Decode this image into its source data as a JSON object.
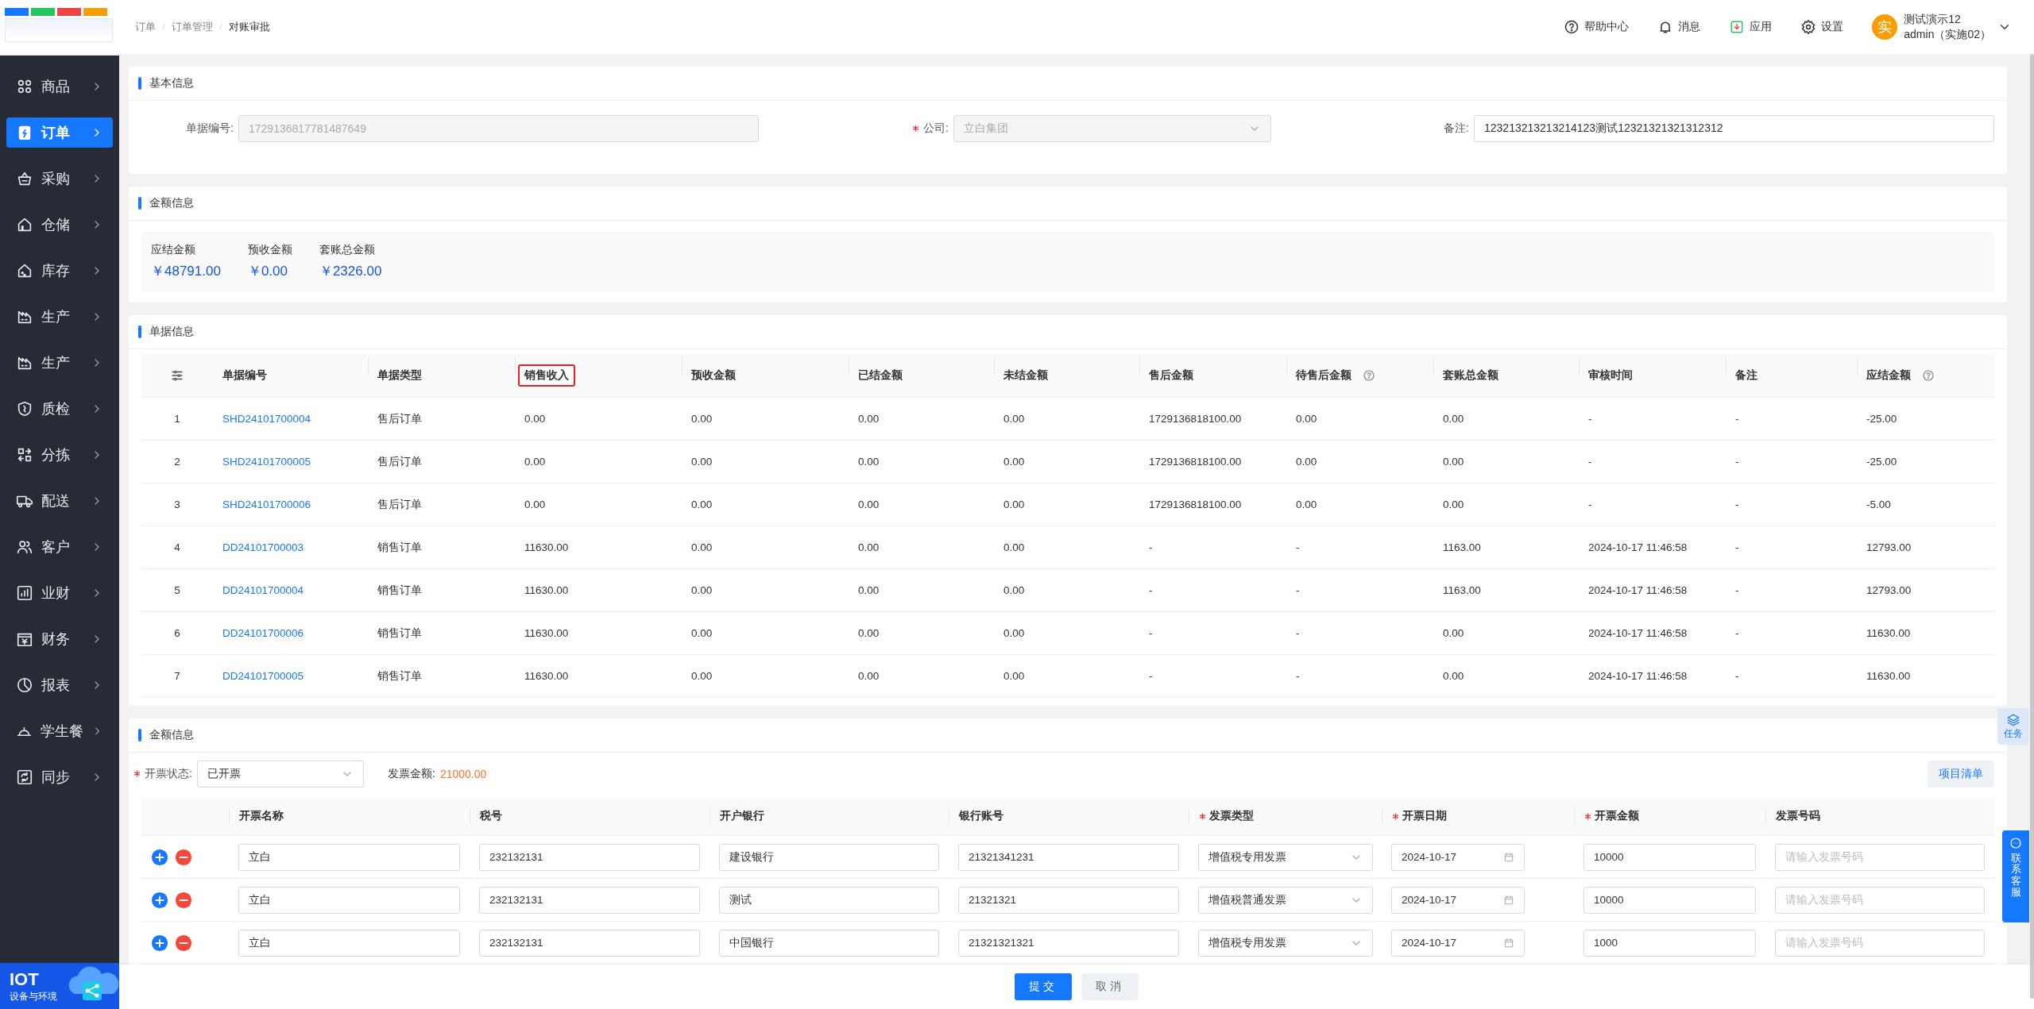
{
  "sidebar": {
    "items": [
      {
        "label": "商品",
        "selected": false
      },
      {
        "label": "订单",
        "selected": true
      },
      {
        "label": "采购",
        "selected": false
      },
      {
        "label": "仓储",
        "selected": false
      },
      {
        "label": "库存",
        "selected": false
      },
      {
        "label": "生产",
        "selected": false
      },
      {
        "label": "生产",
        "selected": false
      },
      {
        "label": "质检",
        "selected": false
      },
      {
        "label": "分拣",
        "selected": false
      },
      {
        "label": "配送",
        "selected": false
      },
      {
        "label": "客户",
        "selected": false
      },
      {
        "label": "业财",
        "selected": false
      },
      {
        "label": "财务",
        "selected": false
      },
      {
        "label": "报表",
        "selected": false
      },
      {
        "label": "学生餐",
        "selected": false
      },
      {
        "label": "同步",
        "selected": false
      }
    ],
    "banner": {
      "title": "IOT",
      "subtitle": "设备与环境"
    }
  },
  "breadcrumb": [
    "订单",
    "订单管理",
    "对账审批"
  ],
  "header_actions": [
    {
      "label": "帮助中心"
    },
    {
      "label": "消息"
    },
    {
      "label": "应用"
    },
    {
      "label": "设置"
    }
  ],
  "user": {
    "avatar_text": "实",
    "name": "测试演示12",
    "role": "admin（实施02）"
  },
  "basic_info": {
    "title": "基本信息",
    "fields": [
      {
        "label": "单据编号:",
        "value": "1729136817781487649",
        "kind": "input",
        "required": false,
        "disabled": true
      },
      {
        "label": "公司:",
        "value": "立白集团",
        "kind": "select",
        "required": true,
        "disabled": true
      },
      {
        "label": "备注:",
        "value": "123213213213214123测试12321321321312312",
        "kind": "input",
        "required": false,
        "disabled": false
      }
    ]
  },
  "amount_info": {
    "title": "金额信息",
    "stats": [
      {
        "label": "应结金额",
        "value": "￥48791.00"
      },
      {
        "label": "预收金额",
        "value": "￥0.00"
      },
      {
        "label": "套账总金额",
        "value": "￥2326.00"
      }
    ]
  },
  "documents": {
    "title": "单据信息",
    "columns": [
      {
        "label": "单据编号",
        "kind": "link",
        "highlighted": false,
        "help": false
      },
      {
        "label": "单据类型",
        "kind": "text",
        "highlighted": false,
        "help": false
      },
      {
        "label": "销售收入",
        "kind": "text",
        "highlighted": true,
        "help": false
      },
      {
        "label": "预收金额",
        "kind": "text",
        "highlighted": false,
        "help": false
      },
      {
        "label": "已结金额",
        "kind": "text",
        "highlighted": false,
        "help": false
      },
      {
        "label": "未结金额",
        "kind": "text",
        "highlighted": false,
        "help": false
      },
      {
        "label": "售后金额",
        "kind": "text",
        "highlighted": false,
        "help": false
      },
      {
        "label": "待售后金额",
        "kind": "text",
        "highlighted": false,
        "help": true
      },
      {
        "label": "套账总金额",
        "kind": "text",
        "highlighted": false,
        "help": false
      },
      {
        "label": "审核时间",
        "kind": "text",
        "highlighted": false,
        "help": false
      },
      {
        "label": "备注",
        "kind": "text",
        "highlighted": false,
        "help": false
      },
      {
        "label": "应结金额",
        "kind": "text",
        "highlighted": false,
        "help": true
      }
    ],
    "rows": [
      {
        "index": "1",
        "cells": [
          "SHD24101700004",
          "售后订单",
          "0.00",
          "0.00",
          "0.00",
          "0.00",
          "1729136818100.00",
          "0.00",
          "0.00",
          "-",
          "-",
          "-25.00"
        ]
      },
      {
        "index": "2",
        "cells": [
          "SHD24101700005",
          "售后订单",
          "0.00",
          "0.00",
          "0.00",
          "0.00",
          "1729136818100.00",
          "0.00",
          "0.00",
          "-",
          "-",
          "-25.00"
        ]
      },
      {
        "index": "3",
        "cells": [
          "SHD24101700006",
          "售后订单",
          "0.00",
          "0.00",
          "0.00",
          "0.00",
          "1729136818100.00",
          "0.00",
          "0.00",
          "-",
          "-",
          "-5.00"
        ]
      },
      {
        "index": "4",
        "cells": [
          "DD24101700003",
          "销售订单",
          "11630.00",
          "0.00",
          "0.00",
          "0.00",
          "-",
          "-",
          "1163.00",
          "2024-10-17 11:46:58",
          "-",
          "12793.00"
        ]
      },
      {
        "index": "5",
        "cells": [
          "DD24101700004",
          "销售订单",
          "11630.00",
          "0.00",
          "0.00",
          "0.00",
          "-",
          "-",
          "1163.00",
          "2024-10-17 11:46:58",
          "-",
          "12793.00"
        ]
      },
      {
        "index": "6",
        "cells": [
          "DD24101700006",
          "销售订单",
          "11630.00",
          "0.00",
          "0.00",
          "0.00",
          "-",
          "-",
          "0.00",
          "2024-10-17 11:46:58",
          "-",
          "11630.00"
        ]
      },
      {
        "index": "7",
        "cells": [
          "DD24101700005",
          "销售订单",
          "11630.00",
          "0.00",
          "0.00",
          "0.00",
          "-",
          "-",
          "0.00",
          "2024-10-17 11:46:58",
          "-",
          "11630.00"
        ]
      }
    ]
  },
  "invoice": {
    "title": "金额信息",
    "status": {
      "label": "开票状态:",
      "required": true,
      "value": "已开票"
    },
    "amount": {
      "label": "发票金额:",
      "value": "21000.00"
    },
    "list_button": "项目清单",
    "columns": [
      {
        "label": "开票名称",
        "kind": "input",
        "required": false
      },
      {
        "label": "税号",
        "kind": "input",
        "required": false
      },
      {
        "label": "开户银行",
        "kind": "input",
        "required": false
      },
      {
        "label": "银行账号",
        "kind": "input",
        "required": false
      },
      {
        "label": "发票类型",
        "kind": "select",
        "required": true
      },
      {
        "label": "开票日期",
        "kind": "date",
        "required": true
      },
      {
        "label": "开票金额",
        "kind": "input",
        "required": true
      },
      {
        "label": "发票号码",
        "kind": "input",
        "required": false
      }
    ],
    "rows": [
      {
        "cells": [
          {
            "value": "立白"
          },
          {
            "value": "232132131"
          },
          {
            "value": "建设银行"
          },
          {
            "value": "21321341231"
          },
          {
            "value": "增值税专用发票"
          },
          {
            "value": "2024-10-17"
          },
          {
            "value": "10000"
          },
          {
            "placeholder": "请输入发票号码"
          }
        ]
      },
      {
        "cells": [
          {
            "value": "立白"
          },
          {
            "value": "232132131"
          },
          {
            "value": "测试"
          },
          {
            "value": "21321321"
          },
          {
            "value": "增值税普通发票"
          },
          {
            "value": "2024-10-17"
          },
          {
            "value": "10000"
          },
          {
            "placeholder": "请输入发票号码"
          }
        ]
      },
      {
        "cells": [
          {
            "value": "立白"
          },
          {
            "value": "232132131"
          },
          {
            "value": "中国银行"
          },
          {
            "value": "21321321321"
          },
          {
            "value": "增值税专用发票"
          },
          {
            "value": "2024-10-17"
          },
          {
            "value": "1000"
          },
          {
            "placeholder": "请输入发票号码"
          }
        ]
      }
    ]
  },
  "footer": {
    "buttons": [
      {
        "label": "提交",
        "kind": "primary"
      },
      {
        "label": "取消",
        "kind": "default"
      }
    ]
  },
  "floating": {
    "task": "任务",
    "contact": "联系客服"
  }
}
